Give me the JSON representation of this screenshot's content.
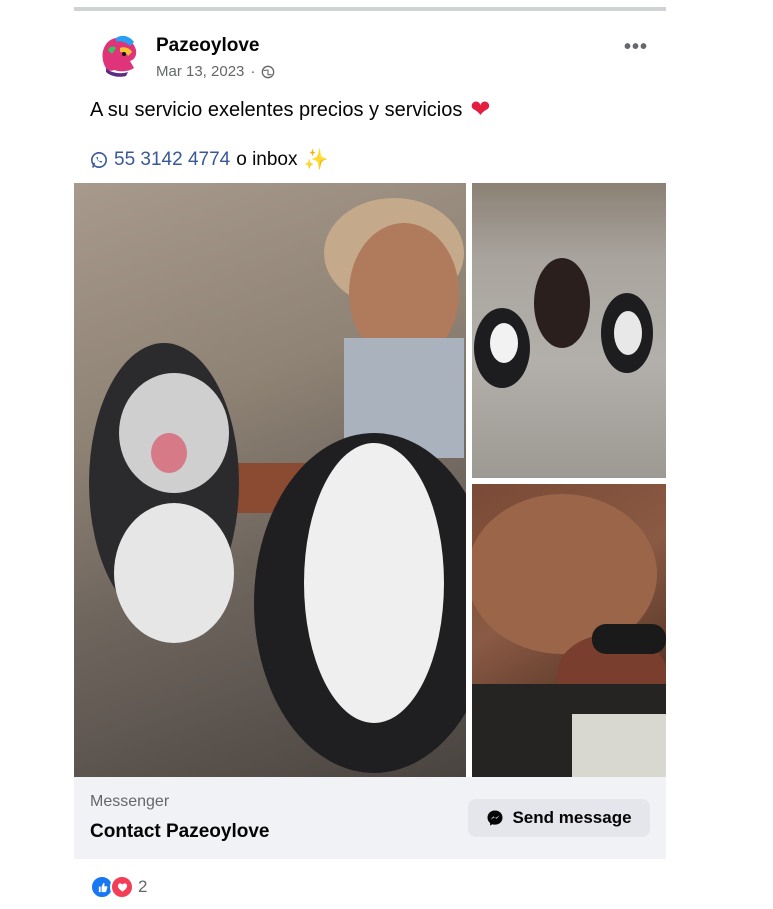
{
  "post": {
    "author": "Pazeoylove",
    "date": "Mar 13, 2023",
    "date_separator": "·",
    "more_label": "•••",
    "message_line1": "A su servicio exelentes precios y servicios",
    "heart_icon": "❤",
    "phone": "55 3142 4774",
    "message_line2_rest": "o inbox",
    "sparkle_icon": "✨"
  },
  "footer": {
    "app_label": "Messenger",
    "contact_label": "Contact Pazeoylove",
    "send_label": "Send message"
  },
  "reactions": {
    "count": "2"
  },
  "colors": {
    "link": "#385898",
    "like_blue": "#1877f2",
    "love_red": "#f33e58",
    "footer_bg": "#f0f2f5"
  }
}
